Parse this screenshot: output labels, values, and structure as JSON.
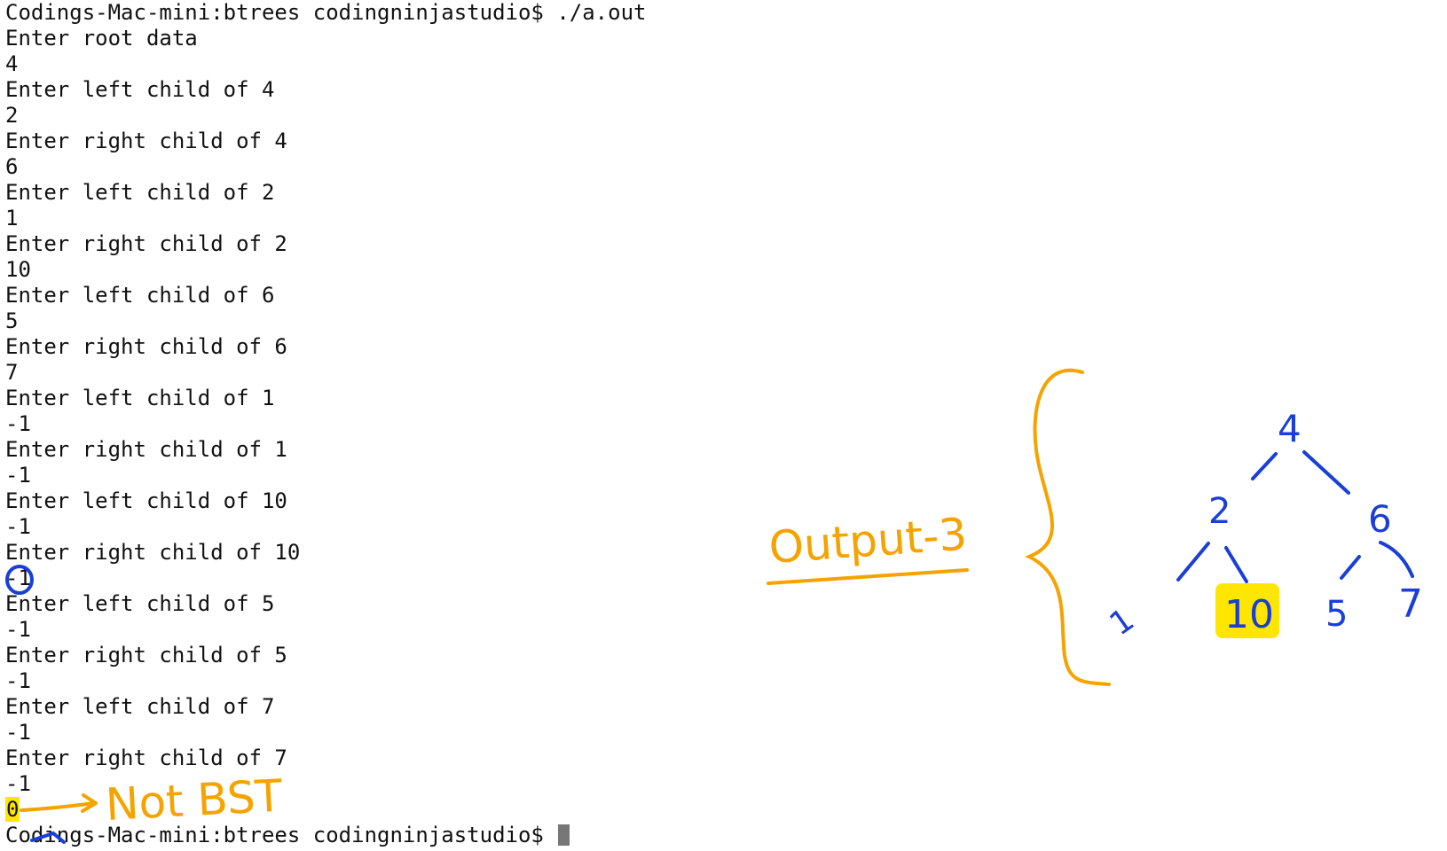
{
  "terminal": {
    "lines": [
      "Codings-Mac-mini:btrees codingninjastudio$ ./a.out",
      "Enter root data",
      "4",
      "Enter left child of 4",
      "2",
      "Enter right child of 4",
      "6",
      "Enter left child of 2",
      "1",
      "Enter right child of 2",
      "10",
      "Enter left child of 6",
      "5",
      "Enter right child of 6",
      "7",
      "Enter left child of 1",
      "-1",
      "Enter right child of 1",
      "-1",
      "Enter left child of 10",
      "-1",
      "Enter right child of 10",
      "-1",
      "Enter left child of 5",
      "-1",
      "Enter right child of 5",
      "-1",
      "Enter left child of 7",
      "-1",
      "Enter right child of 7",
      "-1"
    ],
    "result": "0",
    "prompt": "Codings-Mac-mini:btrees codingninjastudio$ "
  },
  "annotations": {
    "not_bst": "Not BST",
    "output_label": "Output-3",
    "tree": {
      "root": "4",
      "left": "2",
      "right": "6",
      "left_left": "1",
      "left_right": "10",
      "right_left": "5",
      "right_right": "7"
    },
    "colors": {
      "orange": "#f5a300",
      "blue": "#1a3fd6",
      "yellow": "#ffe600"
    }
  }
}
